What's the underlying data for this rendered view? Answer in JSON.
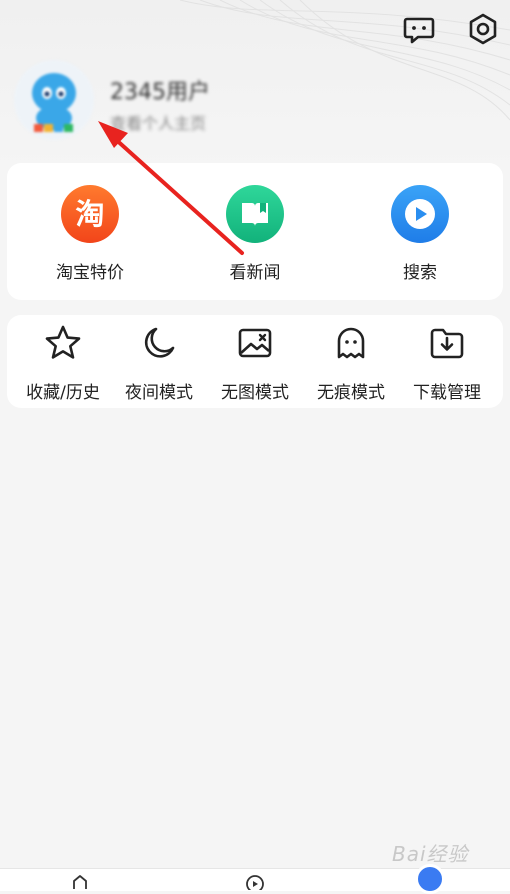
{
  "header": {
    "icons": [
      "message-icon",
      "settings-icon"
    ]
  },
  "user": {
    "name": "2345用户",
    "subtitle": "查看个人主页",
    "avatar_icon": "avatar-mascot"
  },
  "quick_actions": [
    {
      "label": "淘宝特价",
      "icon": "taobao-icon",
      "glyph": "淘",
      "color": "#f2591d"
    },
    {
      "label": "看新闻",
      "icon": "news-book-icon",
      "color": "#20c48a"
    },
    {
      "label": "搜索",
      "icon": "play-search-icon",
      "color": "#2a8ef0"
    }
  ],
  "tools": [
    {
      "label": "收藏/历史",
      "icon": "star-icon"
    },
    {
      "label": "夜间模式",
      "icon": "moon-icon"
    },
    {
      "label": "无图模式",
      "icon": "no-image-icon"
    },
    {
      "label": "无痕模式",
      "icon": "ghost-icon"
    },
    {
      "label": "下载管理",
      "icon": "download-folder-icon"
    }
  ],
  "annotation": {
    "arrow_color": "#e8231f"
  },
  "bottom_nav": {
    "icons": [
      "home-icon",
      "discover-icon",
      "profile-icon"
    ],
    "active_color": "#3a7bf2"
  },
  "watermark": {
    "text": "Bai经验"
  }
}
